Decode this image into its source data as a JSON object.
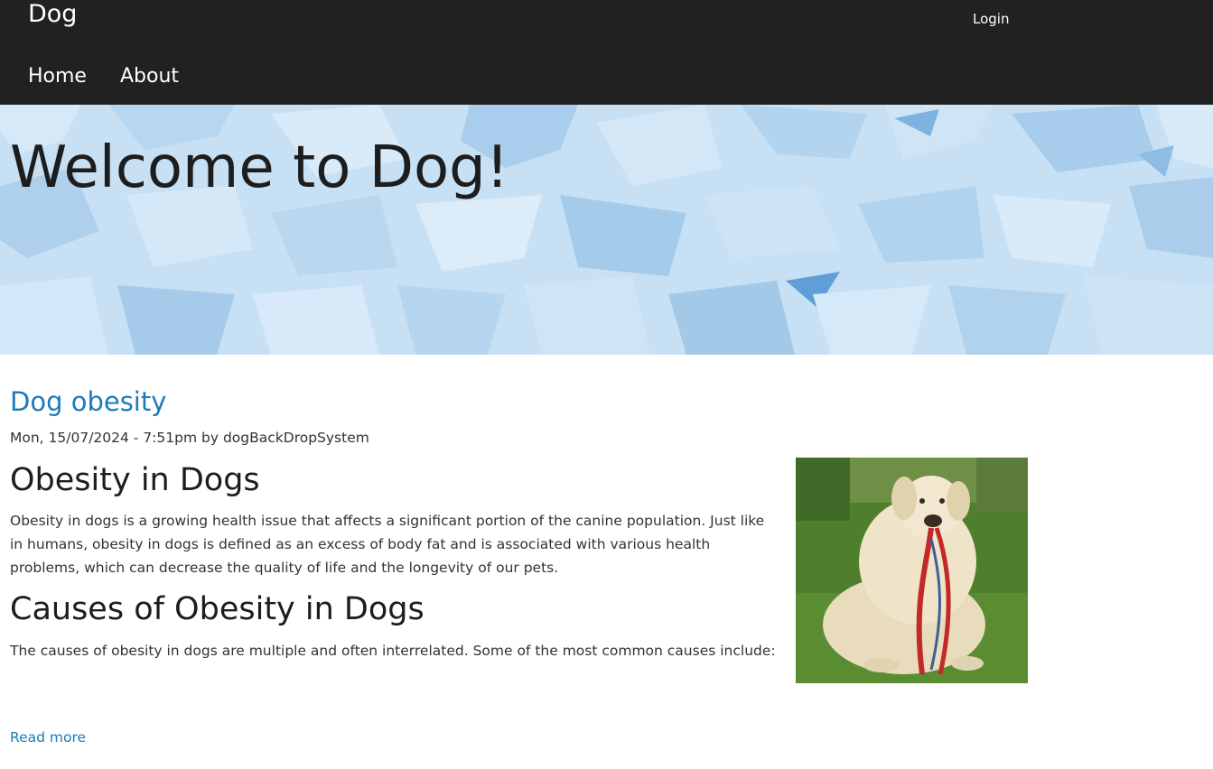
{
  "header": {
    "site_name": "Dog",
    "login_label": "Login",
    "nav": [
      {
        "label": "Home"
      },
      {
        "label": "About"
      }
    ]
  },
  "hero": {
    "title": "Welcome to Dog!"
  },
  "article": {
    "title": "Dog obesity",
    "date": "Mon, 15/07/2024 - 7:51pm",
    "by": "by",
    "author": "dogBackDropSystem",
    "heading1": "Obesity in Dogs",
    "paragraph1": "Obesity in dogs is a growing health issue that affects a significant portion of the canine population. Just like in humans, obesity in dogs is defined as an excess of body fat and is associated with various health problems, which can decrease the quality of life and the longevity of our pets.",
    "heading2": "Causes of Obesity in Dogs",
    "paragraph2": "The causes of obesity in dogs are multiple and often interrelated. Some of the most common causes include:",
    "read_more": "Read more"
  },
  "colors": {
    "header_bg": "#212121",
    "hero_bg": "#c2ddf2",
    "link": "#1a7bb9"
  }
}
